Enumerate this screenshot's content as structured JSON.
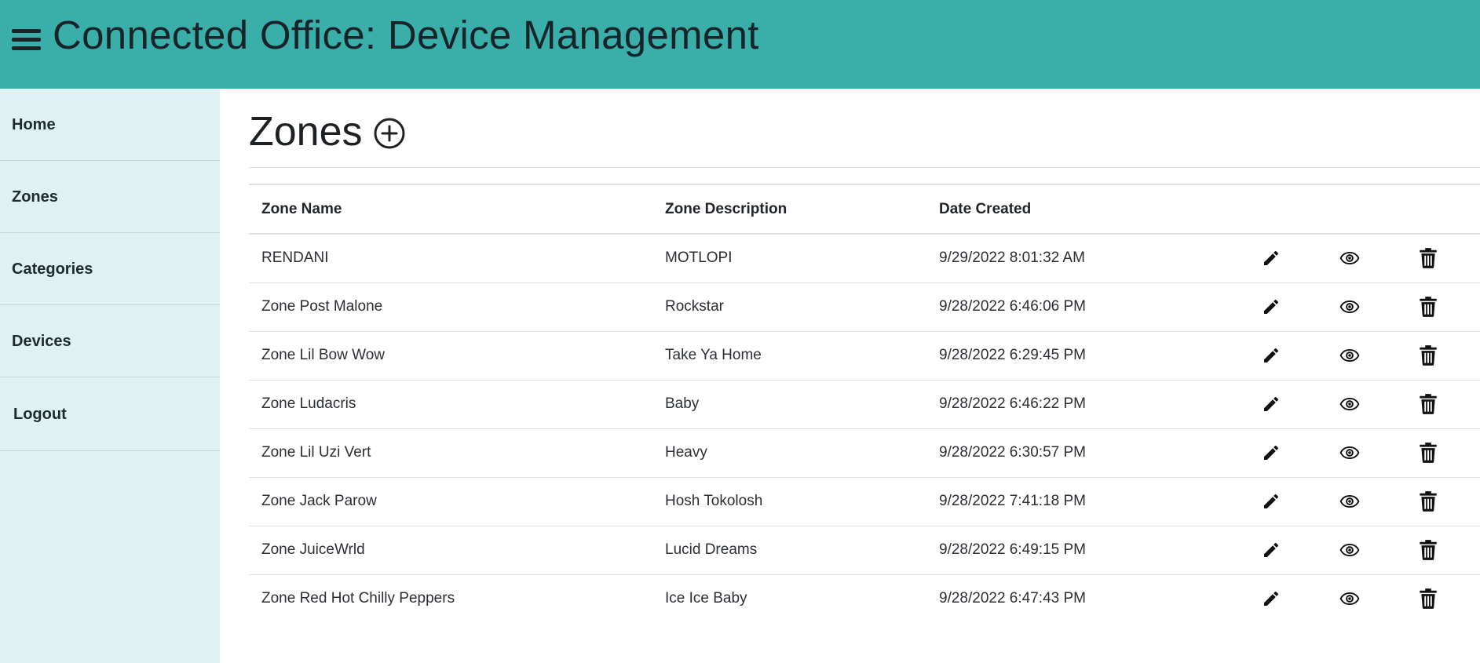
{
  "header": {
    "title": "Connected Office: Device Management",
    "menu_icon": "hamburger-menu-icon",
    "background_color": "#3aafa9"
  },
  "sidebar": {
    "background_color": "#def2f1",
    "items": [
      {
        "label": "Home"
      },
      {
        "label": "Zones"
      },
      {
        "label": "Categories"
      },
      {
        "label": "Devices"
      },
      {
        "label": "Logout"
      }
    ]
  },
  "main": {
    "title": "Zones",
    "add_icon": "circle-plus-icon",
    "table": {
      "columns": [
        "Zone Name",
        "Zone Description",
        "Date Created"
      ],
      "action_icons": [
        "pencil-icon",
        "eye-icon",
        "trash-icon"
      ],
      "rows": [
        {
          "name": "RENDANI",
          "description": "MOTLOPI",
          "created": "9/29/2022 8:01:32 AM"
        },
        {
          "name": "Zone Post Malone",
          "description": "Rockstar",
          "created": "9/28/2022 6:46:06 PM"
        },
        {
          "name": "Zone Lil Bow Wow",
          "description": "Take Ya Home",
          "created": "9/28/2022 6:29:45 PM"
        },
        {
          "name": "Zone Ludacris",
          "description": "Baby",
          "created": "9/28/2022 6:46:22 PM"
        },
        {
          "name": "Zone Lil Uzi Vert",
          "description": "Heavy",
          "created": "9/28/2022 6:30:57 PM"
        },
        {
          "name": "Zone Jack Parow",
          "description": "Hosh Tokolosh",
          "created": "9/28/2022 7:41:18 PM"
        },
        {
          "name": "Zone JuiceWrld",
          "description": "Lucid Dreams",
          "created": "9/28/2022 6:49:15 PM"
        },
        {
          "name": "Zone Red Hot Chilly Peppers",
          "description": "Ice Ice Baby",
          "created": "9/28/2022 6:47:43 PM"
        }
      ]
    }
  }
}
